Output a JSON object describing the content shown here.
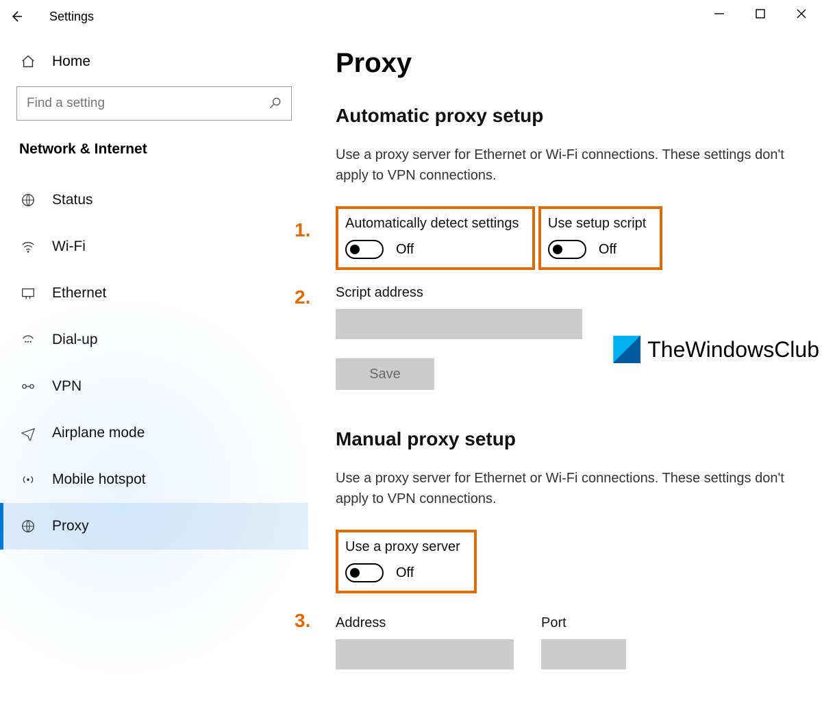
{
  "window": {
    "title": "Settings"
  },
  "sidebar": {
    "home": "Home",
    "search_placeholder": "Find a setting",
    "category": "Network & Internet",
    "items": [
      {
        "label": "Status",
        "icon": "🌐"
      },
      {
        "label": "Wi-Fi",
        "icon": "📶"
      },
      {
        "label": "Ethernet",
        "icon": "🖥"
      },
      {
        "label": "Dial-up",
        "icon": "☎"
      },
      {
        "label": "VPN",
        "icon": "🔗"
      },
      {
        "label": "Airplane mode",
        "icon": "✈"
      },
      {
        "label": "Mobile hotspot",
        "icon": "📡"
      },
      {
        "label": "Proxy",
        "icon": "🌐",
        "selected": true
      }
    ]
  },
  "page": {
    "title": "Proxy",
    "auto": {
      "heading": "Automatic proxy setup",
      "desc": "Use a proxy server for Ethernet or Wi-Fi connections. These settings don't apply to VPN connections.",
      "detect_label": "Automatically detect settings",
      "detect_state": "Off",
      "script_label": "Use setup script",
      "script_state": "Off",
      "script_addr_label": "Script address",
      "save": "Save"
    },
    "manual": {
      "heading": "Manual proxy setup",
      "desc": "Use a proxy server for Ethernet or Wi-Fi connections. These settings don't apply to VPN connections.",
      "use_label": "Use a proxy server",
      "use_state": "Off",
      "addr_label": "Address",
      "port_label": "Port"
    }
  },
  "annotations": {
    "n1": "1.",
    "n2": "2.",
    "n3": "3."
  },
  "watermark": "TheWindowsClub"
}
